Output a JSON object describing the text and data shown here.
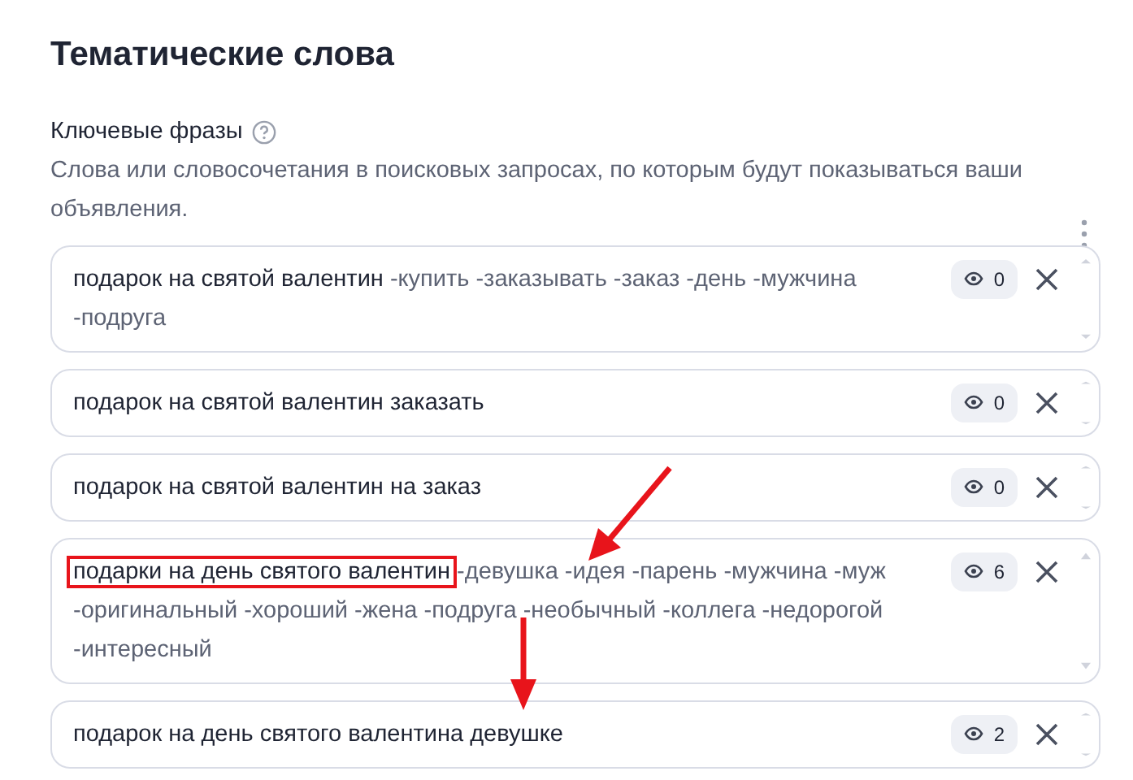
{
  "title": "Тематические слова",
  "field": {
    "label": "Ключевые фразы",
    "description": "Слова или словосочетания в поисковых запросах, по которым будут показываться ваши объявления."
  },
  "phrases": [
    {
      "phrase": "подарок на святой валентин",
      "minus_words": "-купить -заказывать -заказ -день -мужчина -подруга",
      "impressions": "0",
      "highlighted": false
    },
    {
      "phrase": "подарок на святой валентин заказать",
      "impressions": "0",
      "highlighted": false
    },
    {
      "phrase": "подарок на святой валентин на заказ",
      "impressions": "0",
      "highlighted": false
    },
    {
      "phrase": "подарки на день святого валентин",
      "minus_words": "-девушка -идея -парень -мужчина -муж -оригинальный -хороший -жена -подруга -необычный -коллега -недорогой -интересный",
      "impressions": "6",
      "highlighted": true
    },
    {
      "phrase": "подарок на день святого валентина девушке",
      "impressions": "2",
      "highlighted": false
    }
  ]
}
